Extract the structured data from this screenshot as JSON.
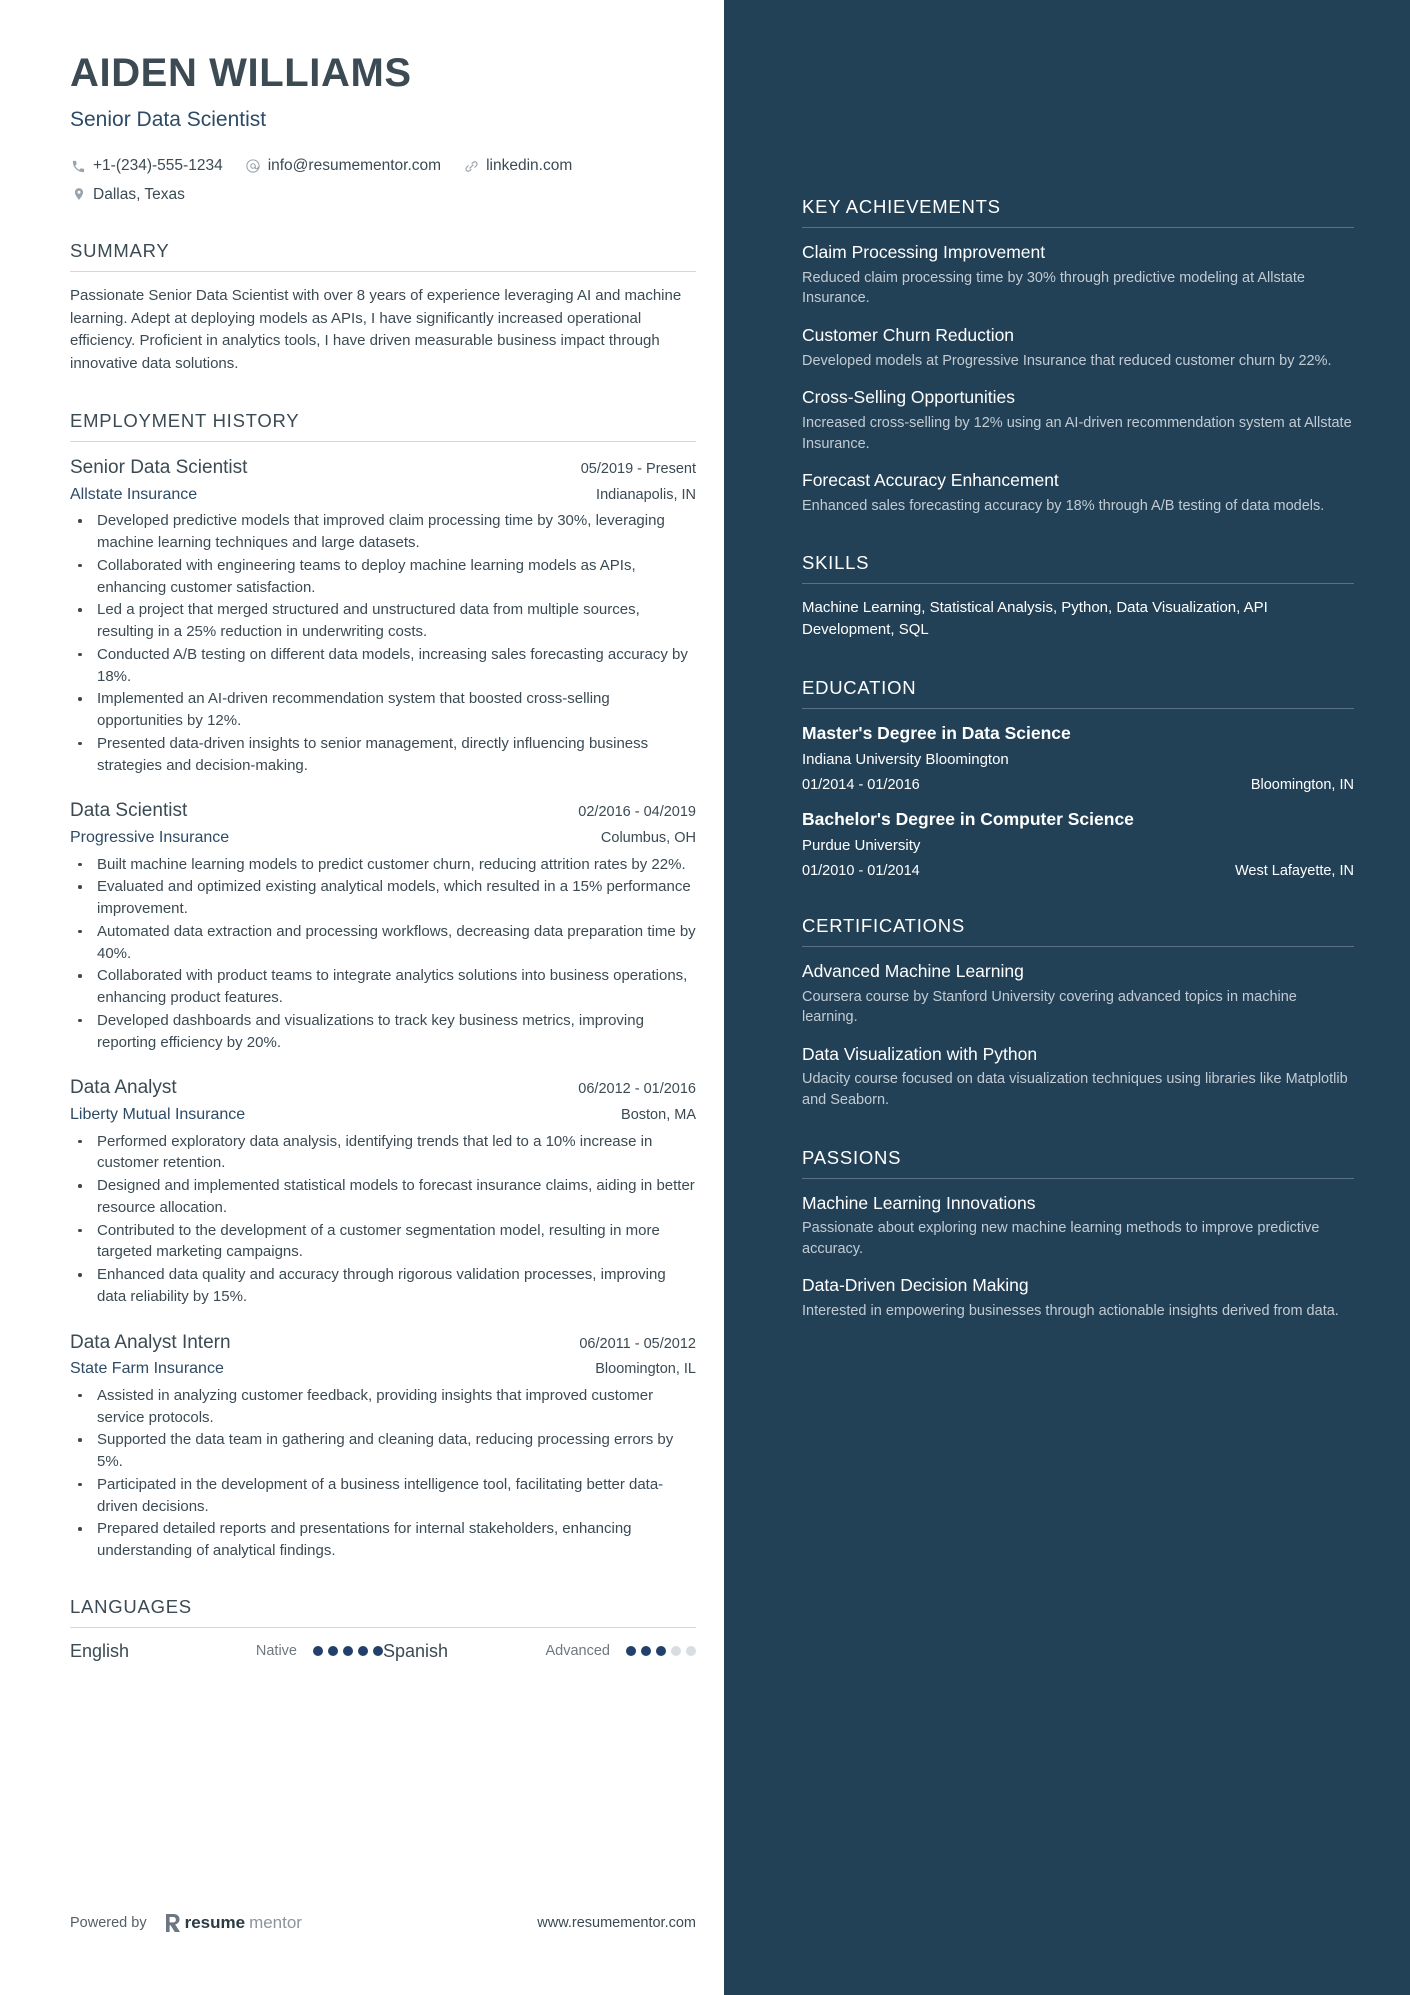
{
  "colors": {
    "sidebar_bg": "#234156",
    "heading": "#3b4a53",
    "accent": "#2d4b66",
    "dot_filled": "#22406b",
    "dot_empty": "#d9dde0"
  },
  "header": {
    "name": "AIDEN WILLIAMS",
    "title": "Senior Data Scientist",
    "contacts": [
      {
        "icon": "phone-icon",
        "text": "+1-(234)-555-1234"
      },
      {
        "icon": "email-icon",
        "text": "info@resumementor.com"
      },
      {
        "icon": "link-icon",
        "text": "linkedin.com"
      }
    ],
    "location": {
      "icon": "location-pin-icon",
      "text": "Dallas, Texas"
    }
  },
  "summary": {
    "title": "SUMMARY",
    "text": "Passionate Senior Data Scientist with over 8 years of experience leveraging AI and machine learning. Adept at deploying models as APIs, I have significantly increased operational efficiency. Proficient in analytics tools, I have driven measurable business impact through innovative data solutions."
  },
  "employment": {
    "title": "EMPLOYMENT HISTORY",
    "jobs": [
      {
        "position": "Senior Data Scientist",
        "dates": "05/2019 - Present",
        "company": "Allstate Insurance",
        "location": "Indianapolis, IN",
        "bullets": [
          "Developed predictive models that improved claim processing time by 30%, leveraging machine learning techniques and large datasets.",
          "Collaborated with engineering teams to deploy machine learning models as APIs, enhancing customer satisfaction.",
          "Led a project that merged structured and unstructured data from multiple sources, resulting in a 25% reduction in underwriting costs.",
          "Conducted A/B testing on different data models, increasing sales forecasting accuracy by 18%.",
          "Implemented an AI-driven recommendation system that boosted cross-selling opportunities by 12%.",
          "Presented data-driven insights to senior management, directly influencing business strategies and decision-making."
        ]
      },
      {
        "position": "Data Scientist",
        "dates": "02/2016 - 04/2019",
        "company": "Progressive Insurance",
        "location": "Columbus, OH",
        "bullets": [
          "Built machine learning models to predict customer churn, reducing attrition rates by 22%.",
          "Evaluated and optimized existing analytical models, which resulted in a 15% performance improvement.",
          "Automated data extraction and processing workflows, decreasing data preparation time by 40%.",
          "Collaborated with product teams to integrate analytics solutions into business operations, enhancing product features.",
          "Developed dashboards and visualizations to track key business metrics, improving reporting efficiency by 20%."
        ]
      },
      {
        "position": "Data Analyst",
        "dates": "06/2012 - 01/2016",
        "company": "Liberty Mutual Insurance",
        "location": "Boston, MA",
        "bullets": [
          "Performed exploratory data analysis, identifying trends that led to a 10% increase in customer retention.",
          "Designed and implemented statistical models to forecast insurance claims, aiding in better resource allocation.",
          "Contributed to the development of a customer segmentation model, resulting in more targeted marketing campaigns.",
          "Enhanced data quality and accuracy through rigorous validation processes, improving data reliability by 15%."
        ]
      },
      {
        "position": "Data Analyst Intern",
        "dates": "06/2011 - 05/2012",
        "company": "State Farm Insurance",
        "location": "Bloomington, IL",
        "bullets": [
          "Assisted in analyzing customer feedback, providing insights that improved customer service protocols.",
          "Supported the data team in gathering and cleaning data, reducing processing errors by 5%.",
          "Participated in the development of a business intelligence tool, facilitating better data-driven decisions.",
          "Prepared detailed reports and presentations for internal stakeholders, enhancing understanding of analytical findings."
        ]
      }
    ]
  },
  "languages": {
    "title": "LANGUAGES",
    "items": [
      {
        "name": "English",
        "level": "Native",
        "filled": 5,
        "total": 5
      },
      {
        "name": "Spanish",
        "level": "Advanced",
        "filled": 3,
        "total": 5
      }
    ]
  },
  "footer": {
    "powered_by": "Powered by",
    "brand_first": "resume",
    "brand_second": "mentor",
    "url": "www.resumementor.com"
  },
  "sidebar": {
    "key_achievements": {
      "title": "KEY ACHIEVEMENTS",
      "items": [
        {
          "title": "Claim Processing Improvement",
          "desc": "Reduced claim processing time by 30% through predictive modeling at Allstate Insurance."
        },
        {
          "title": "Customer Churn Reduction",
          "desc": "Developed models at Progressive Insurance that reduced customer churn by 22%."
        },
        {
          "title": "Cross-Selling Opportunities",
          "desc": "Increased cross-selling by 12% using an AI-driven recommendation system at Allstate Insurance."
        },
        {
          "title": "Forecast Accuracy Enhancement",
          "desc": "Enhanced sales forecasting accuracy by 18% through A/B testing of data models."
        }
      ]
    },
    "skills": {
      "title": "SKILLS",
      "text": "Machine Learning, Statistical Analysis, Python, Data Visualization, API Development, SQL"
    },
    "education": {
      "title": "EDUCATION",
      "items": [
        {
          "degree": "Master's Degree in Data Science",
          "school": "Indiana University Bloomington",
          "dates": "01/2014 - 01/2016",
          "location": "Bloomington, IN"
        },
        {
          "degree": "Bachelor's Degree in Computer Science",
          "school": "Purdue University",
          "dates": "01/2010 - 01/2014",
          "location": "West Lafayette, IN"
        }
      ]
    },
    "certifications": {
      "title": "CERTIFICATIONS",
      "items": [
        {
          "title": "Advanced Machine Learning",
          "desc": "Coursera course by Stanford University covering advanced topics in machine learning."
        },
        {
          "title": "Data Visualization with Python",
          "desc": "Udacity course focused on data visualization techniques using libraries like Matplotlib and Seaborn."
        }
      ]
    },
    "passions": {
      "title": "PASSIONS",
      "items": [
        {
          "title": "Machine Learning Innovations",
          "desc": "Passionate about exploring new machine learning methods to improve predictive accuracy."
        },
        {
          "title": "Data-Driven Decision Making",
          "desc": "Interested in empowering businesses through actionable insights derived from data."
        }
      ]
    }
  }
}
